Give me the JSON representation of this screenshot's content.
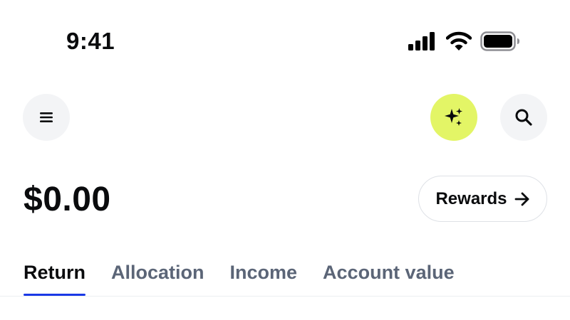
{
  "status_bar": {
    "time": "9:41",
    "icons": [
      "cellular-signal-icon",
      "wifi-icon",
      "battery-icon"
    ]
  },
  "header": {
    "menu_icon": "hamburger-menu-icon",
    "assistant_icon": "sparkle-icon",
    "search_icon": "search-icon",
    "assistant_color": "#e3f566"
  },
  "balance": {
    "value": "$0.00"
  },
  "rewards": {
    "label": "Rewards",
    "icon": "arrow-right-icon"
  },
  "tabs": [
    {
      "label": "Return",
      "active": true
    },
    {
      "label": "Allocation",
      "active": false
    },
    {
      "label": "Income",
      "active": false
    },
    {
      "label": "Account value",
      "active": false
    }
  ],
  "colors": {
    "tab_indicator": "#1a39e6",
    "inactive_tab": "#5b6577",
    "text": "#0a0b0d"
  }
}
